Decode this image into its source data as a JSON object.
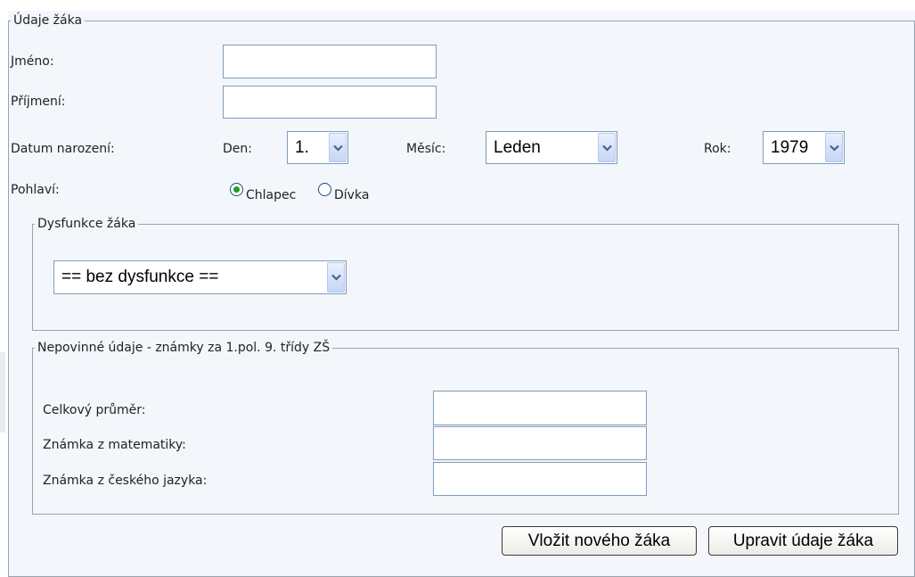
{
  "student_section": {
    "legend": "Údaje žáka",
    "first_name": {
      "label": "Jméno:",
      "value": ""
    },
    "last_name": {
      "label": "Příjmení:",
      "value": ""
    },
    "birth_date": {
      "label": "Datum narození:",
      "day_label": "Den:",
      "day_value": "1.",
      "month_label": "Měsíc:",
      "month_value": "Leden",
      "year_label": "Rok:",
      "year_value": "1979"
    },
    "gender": {
      "label": "Pohlaví:",
      "options": [
        "Chlapec",
        "Dívka"
      ],
      "selected": "Chlapec"
    }
  },
  "dysfunction_section": {
    "legend": "Dysfunkce žáka",
    "value": "== bez dysfunkce =="
  },
  "optional_section": {
    "legend": "Nepovinné údaje - známky za 1.pol. 9. třídy ZŠ",
    "average": {
      "label": "Celkový průměr:",
      "value": ""
    },
    "math": {
      "label": "Známka z matematiky:",
      "value": ""
    },
    "czech": {
      "label": "Známka z českého jazyka:",
      "value": ""
    }
  },
  "actions": {
    "insert_label": "Vložit nového žáka",
    "update_label": "Upravit údaje žáka"
  },
  "colors": {
    "panel_background": "#f3f6fb",
    "radio_selected": "#21a121",
    "input_border": "#7f9db9"
  },
  "icons": [
    "chevron-down-icon",
    "radio-selected-icon",
    "radio-unselected-icon"
  ]
}
